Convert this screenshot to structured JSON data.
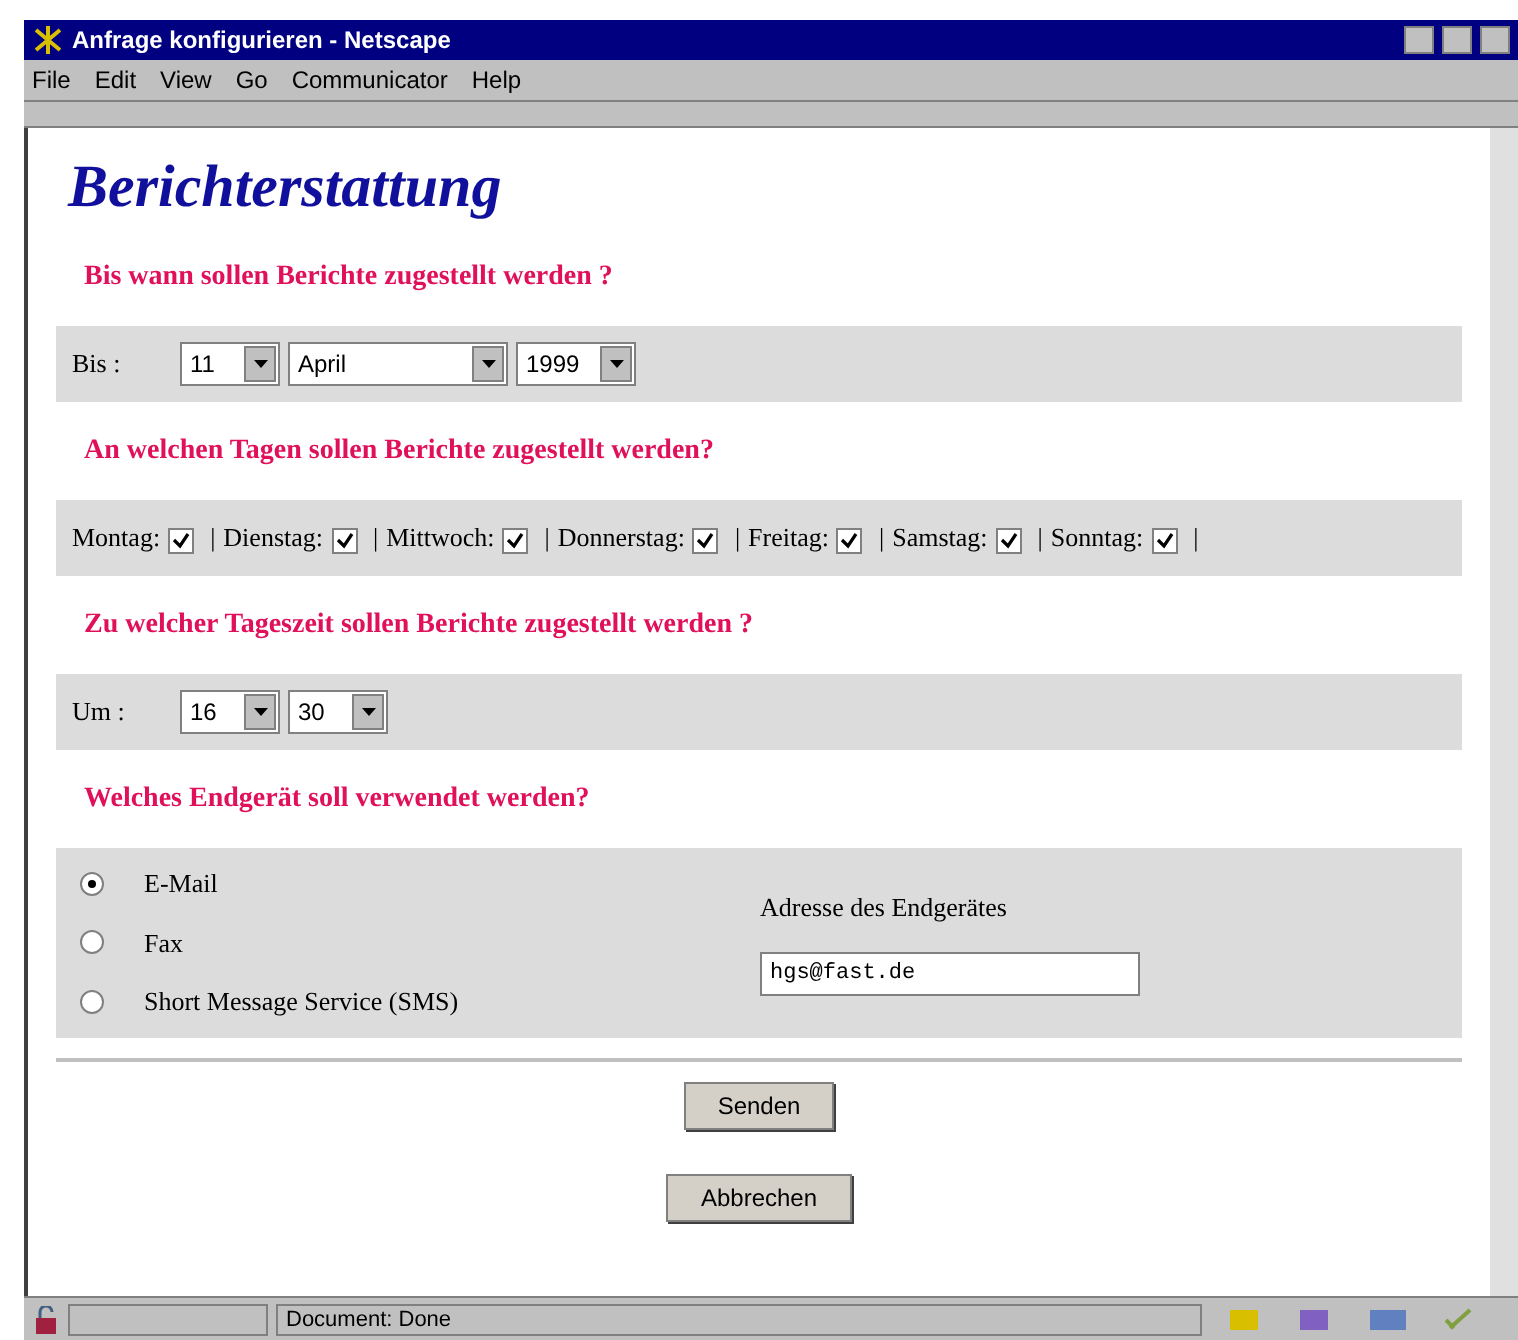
{
  "window": {
    "title": "Anfrage konfigurieren - Netscape"
  },
  "menu": [
    "File",
    "Edit",
    "View",
    "Go",
    "Communicator",
    "Help"
  ],
  "page": {
    "heading": "Berichterstattung",
    "sections": [
      {
        "kind": "date",
        "question": "Bis wann sollen Berichte zugestellt werden ?",
        "label": "Bis :",
        "selects": [
          "11",
          "April",
          "1999"
        ]
      },
      {
        "kind": "days",
        "question": "An welchen Tagen sollen Berichte zugestellt werden?",
        "days": [
          {
            "label": "Montag:",
            "checked": true
          },
          {
            "label": "Dienstag:",
            "checked": true
          },
          {
            "label": "Mittwoch:",
            "checked": true
          },
          {
            "label": "Donnerstag:",
            "checked": true
          },
          {
            "label": "Freitag:",
            "checked": true
          },
          {
            "label": "Samstag:",
            "checked": true
          },
          {
            "label": "Sonntag:",
            "checked": true
          }
        ],
        "separator": "|"
      },
      {
        "kind": "time",
        "question": "Zu welcher Tageszeit sollen Berichte zugestellt werden ?",
        "label": "Um :",
        "selects": [
          "16",
          "30"
        ]
      },
      {
        "kind": "device",
        "question": "Welches Endgerät soll verwendet werden?",
        "options": [
          {
            "label": "E-Mail",
            "selected": true
          },
          {
            "label": "Fax",
            "selected": false
          },
          {
            "label": "Short Message Service (SMS)",
            "selected": false
          }
        ],
        "address_label": "Adresse des Endgerätes",
        "address": "hgs@fast.de"
      }
    ],
    "buttons": [
      "Senden",
      "Abbrechen"
    ]
  },
  "status_bar": {
    "text": "Document: Done"
  }
}
